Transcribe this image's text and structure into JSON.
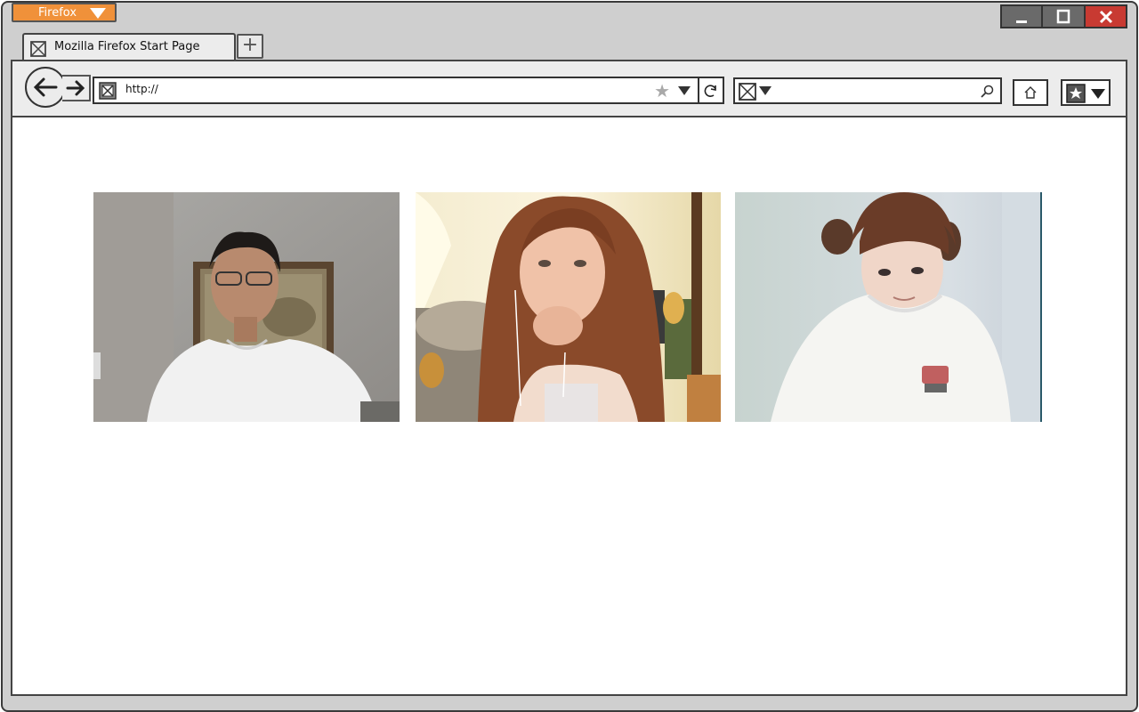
{
  "app": {
    "menu_button": "Firefox"
  },
  "tabs": [
    {
      "title": "Mozilla Firefox Start Page"
    }
  ],
  "address_bar": {
    "url": "http://"
  },
  "icons": {
    "back": "back-arrow-icon",
    "forward": "forward-arrow-icon",
    "reload": "reload-icon",
    "star": "bookmark-star-icon",
    "search": "search-magnifier-icon",
    "home": "home-icon",
    "bookmarks": "bookmarks-menu-icon",
    "minimize": "minimize-icon",
    "maximize": "maximize-icon",
    "close": "close-icon",
    "new_tab": "plus-icon",
    "favicon": "placeholder-image-icon"
  },
  "colors": {
    "firefox_button": "#f0913a",
    "close_button": "#c83a32",
    "window_controls": "#6a6a6a",
    "chrome": "#cfcfcf"
  },
  "content": {
    "photos": [
      {
        "description_name": "webcam-photo-man"
      },
      {
        "description_name": "webcam-photo-woman-long-hair"
      },
      {
        "description_name": "webcam-photo-woman-pigtails"
      }
    ]
  }
}
